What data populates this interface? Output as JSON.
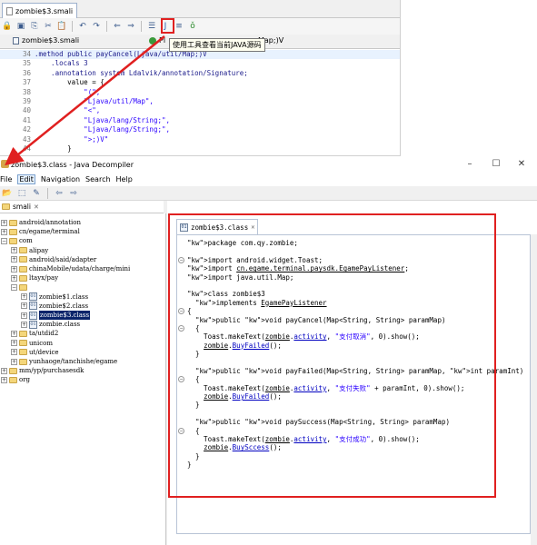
{
  "top_editor": {
    "tab_title": "zombie$3.smali",
    "subtab_title": "zombie$3.smali",
    "subtab_right_fragment": "Pl",
    "subtab_tail": "Map;)V",
    "tooltip": "使用工具查看当前JAVA源码",
    "lines": [
      {
        "n": "34",
        "text": ".method public payCancel(Ljava/util/Map;)V"
      },
      {
        "n": "35",
        "text": "    .locals 3"
      },
      {
        "n": "36",
        "text": "    .annotation system Ldalvik/annotation/Signature;"
      },
      {
        "n": "37",
        "text": "        value = {"
      },
      {
        "n": "38",
        "text": "            \"(\","
      },
      {
        "n": "39",
        "text": "            \"Ljava/util/Map\","
      },
      {
        "n": "40",
        "text": "            \"<\","
      },
      {
        "n": "41",
        "text": "            \"Ljava/lang/String;\","
      },
      {
        "n": "42",
        "text": "            \"Ljava/lang/String;\","
      },
      {
        "n": "43",
        "text": "            \">;)V\""
      },
      {
        "n": "44",
        "text": "        }"
      }
    ]
  },
  "decompiler": {
    "title": "zombie$3.class - Java Decompiler",
    "controls": {
      "minimize": "–",
      "maximize": "☐",
      "close": "✕"
    },
    "menu": [
      "File",
      "Edit",
      "Navigation",
      "Search",
      "Help"
    ],
    "tree_tab": "smali",
    "tree": [
      {
        "label": "android/annotation",
        "depth": 0,
        "type": "folder",
        "exp": "+"
      },
      {
        "label": "cn/egame/terminal",
        "depth": 0,
        "type": "folder",
        "exp": "+"
      },
      {
        "label": "com",
        "depth": 0,
        "type": "folder",
        "exp": "−"
      },
      {
        "label": "alipay",
        "depth": 1,
        "type": "folder",
        "exp": "+"
      },
      {
        "label": "android/said/adapter",
        "depth": 1,
        "type": "folder",
        "exp": "+"
      },
      {
        "label": "chinaMobile/udata/charge/mini",
        "depth": 1,
        "type": "folder",
        "exp": "+"
      },
      {
        "label": "ltayx/pay",
        "depth": 1,
        "type": "folder",
        "exp": "+"
      },
      {
        "label": "",
        "depth": 1,
        "type": "folder",
        "exp": "−"
      },
      {
        "label": "zombie$1.class",
        "depth": 2,
        "type": "class",
        "exp": "+"
      },
      {
        "label": "zombie$2.class",
        "depth": 2,
        "type": "class",
        "exp": "+"
      },
      {
        "label": "zombie$3.class",
        "depth": 2,
        "type": "class",
        "exp": "+",
        "selected": true
      },
      {
        "label": "zombie.class",
        "depth": 2,
        "type": "class",
        "exp": "+"
      },
      {
        "label": "ta/utdid2",
        "depth": 1,
        "type": "folder",
        "exp": "+"
      },
      {
        "label": "unicom",
        "depth": 1,
        "type": "folder",
        "exp": "+"
      },
      {
        "label": "ut/device",
        "depth": 1,
        "type": "folder",
        "exp": "+"
      },
      {
        "label": "yunhaoge/tanchishe/egame",
        "depth": 1,
        "type": "folder",
        "exp": "+"
      },
      {
        "label": "mm/yp/purchasesdk",
        "depth": 0,
        "type": "folder",
        "exp": "+"
      },
      {
        "label": "org",
        "depth": 0,
        "type": "folder",
        "exp": "+"
      }
    ],
    "class_tab": "zombie$3.class",
    "code": [
      {
        "fold": "",
        "html": "package com.qy.zombie;",
        "kind": "pkg"
      },
      {
        "fold": "",
        "html": "",
        "kind": "blank"
      },
      {
        "fold": "−",
        "html": "import android.widget.Toast;",
        "kind": "import"
      },
      {
        "fold": "",
        "html": "import cn.egame.terminal.paysdk.EgamePayListener;",
        "kind": "import2"
      },
      {
        "fold": "",
        "html": "import java.util.Map;",
        "kind": "import"
      },
      {
        "fold": "",
        "html": "",
        "kind": "blank"
      },
      {
        "fold": "",
        "html": "class zombie$3",
        "kind": "class"
      },
      {
        "fold": "",
        "html": "  implements EgamePayListener",
        "kind": "impl"
      },
      {
        "fold": "−",
        "html": "{",
        "kind": "plain"
      },
      {
        "fold": "",
        "html": "  public void payCancel(Map<String, String> paramMap)",
        "kind": "method"
      },
      {
        "fold": "−",
        "html": "  {",
        "kind": "plain"
      },
      {
        "fold": "",
        "html": "    Toast.makeText(zombie.activity, \"支付取消\", 0).show();",
        "kind": "toast"
      },
      {
        "fold": "",
        "html": "    zombie.BuyFailed();",
        "kind": "call"
      },
      {
        "fold": "",
        "html": "  }",
        "kind": "plain"
      },
      {
        "fold": "",
        "html": "",
        "kind": "blank"
      },
      {
        "fold": "",
        "html": "  public void payFailed(Map<String, String> paramMap, int paramInt)",
        "kind": "method"
      },
      {
        "fold": "−",
        "html": "  {",
        "kind": "plain"
      },
      {
        "fold": "",
        "html": "    Toast.makeText(zombie.activity, \"支付失败\" + paramInt, 0).show();",
        "kind": "toast"
      },
      {
        "fold": "",
        "html": "    zombie.BuyFailed();",
        "kind": "call"
      },
      {
        "fold": "",
        "html": "  }",
        "kind": "plain"
      },
      {
        "fold": "",
        "html": "",
        "kind": "blank"
      },
      {
        "fold": "",
        "html": "  public void paySuccess(Map<String, String> paramMap)",
        "kind": "method"
      },
      {
        "fold": "−",
        "html": "  {",
        "kind": "plain"
      },
      {
        "fold": "",
        "html": "    Toast.makeText(zombie.activity, \"支付成功\", 0).show();",
        "kind": "toast"
      },
      {
        "fold": "",
        "html": "    zombie.BuySccess();",
        "kind": "call"
      },
      {
        "fold": "",
        "html": "  }",
        "kind": "plain"
      },
      {
        "fold": "",
        "html": "}",
        "kind": "plain"
      }
    ]
  },
  "colors": {
    "annotation_red": "#e02020",
    "selection": "#0a246a",
    "keyword": "#7f0055",
    "string": "#2a00ff"
  }
}
